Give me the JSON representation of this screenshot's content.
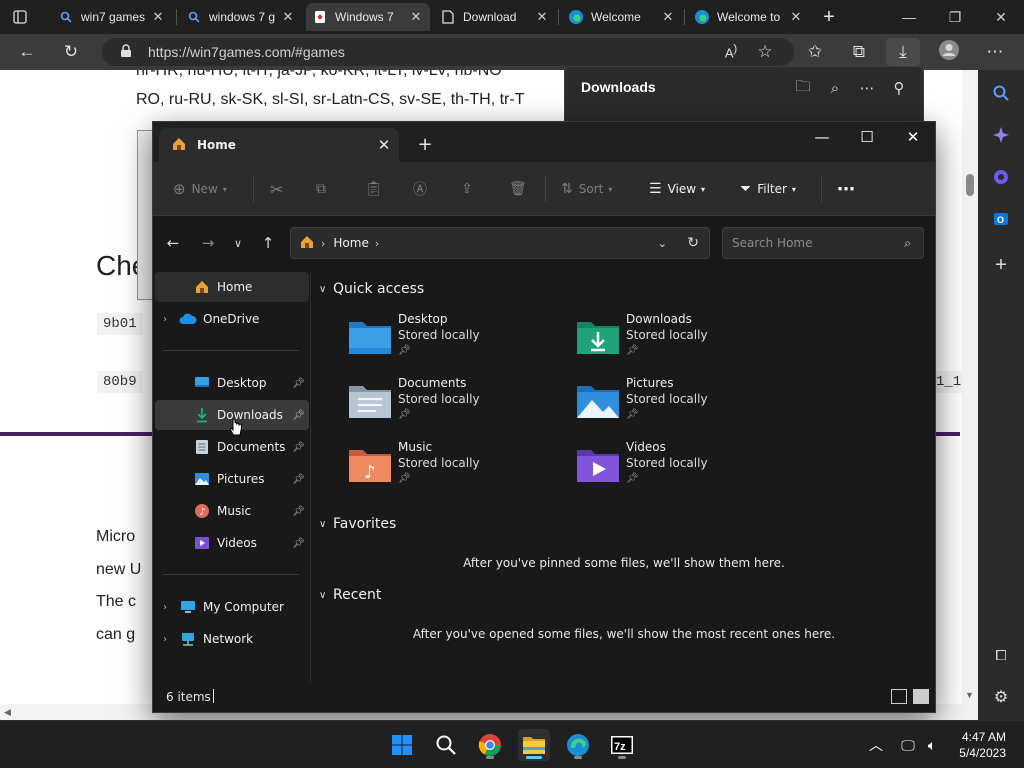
{
  "browser": {
    "tabs": [
      {
        "label": "win7 games",
        "icon": "search-icon"
      },
      {
        "label": "windows 7 g",
        "icon": "search-icon"
      },
      {
        "label": "Windows 7",
        "icon": "cards-icon",
        "active": true
      },
      {
        "label": "Download",
        "icon": "document-icon"
      },
      {
        "label": "Welcome",
        "icon": "edge-icon"
      },
      {
        "label": "Welcome to",
        "icon": "edge-icon"
      }
    ],
    "url": "https://win7games.com/#games"
  },
  "webpage": {
    "line1": "hr-HR, hu-HU, it-IT, ja-JP, ko-KR, lt-LT, lv-LV, nb-NO",
    "line2": "RO, ru-RU, sk-SK, sl-SI, sr-Latn-CS, sv-SE, th-TH, tr-T",
    "heading": "Che",
    "code1": "9b01",
    "code2": "80b9",
    "code2_tail": "1_1",
    "para": [
      "Micro",
      "new U",
      "The c",
      "can g"
    ]
  },
  "downloads_panel": {
    "title": "Downloads"
  },
  "explorer": {
    "tab_title": "Home",
    "commands": {
      "new": "New",
      "sort": "Sort",
      "view": "View",
      "filter": "Filter"
    },
    "breadcrumb": "Home",
    "search_placeholder": "Search Home",
    "nav": {
      "home": "Home",
      "onedrive": "OneDrive",
      "desktop": "Desktop",
      "downloads": "Downloads",
      "documents": "Documents",
      "pictures": "Pictures",
      "music": "Music",
      "videos": "Videos",
      "my_computer": "My Computer",
      "network": "Network"
    },
    "sections": {
      "quick_access": "Quick access",
      "favorites": "Favorites",
      "recent": "Recent"
    },
    "quick_items": [
      {
        "name": "Desktop",
        "status": "Stored locally"
      },
      {
        "name": "Downloads",
        "status": "Stored locally"
      },
      {
        "name": "Documents",
        "status": "Stored locally"
      },
      {
        "name": "Pictures",
        "status": "Stored locally"
      },
      {
        "name": "Music",
        "status": "Stored locally"
      },
      {
        "name": "Videos",
        "status": "Stored locally"
      }
    ],
    "favorites_empty": "After you've pinned some files, we'll show them here.",
    "recent_empty": "After you've opened some files, we'll show the most recent ones here.",
    "status": "6 items"
  },
  "taskbar": {
    "time": "4:47 AM",
    "date": "5/4/2023"
  },
  "colors": {
    "folder_blue": "#3a9be0",
    "download_green": "#1fa37a",
    "purple_line": "#4a2064",
    "accent": "#60cdff"
  }
}
